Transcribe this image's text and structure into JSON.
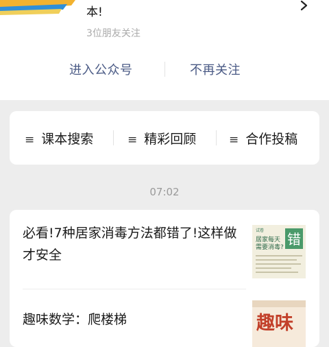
{
  "profile": {
    "description_tail": "本!",
    "followers_text": "3位朋友关注",
    "enter_button": "进入公众号",
    "unfollow_button": "不再关注"
  },
  "menu": {
    "items": [
      {
        "label": "课本搜索",
        "icon": "menu-lines-icon"
      },
      {
        "label": "精彩回顾",
        "icon": "menu-lines-icon"
      },
      {
        "label": "合作投稿",
        "icon": "menu-lines-icon"
      }
    ]
  },
  "timestamp": "07:02",
  "articles": [
    {
      "title": "必看!7种居家消毒方法都错了!这样做才安全",
      "thumbnail": {
        "brand": "试卷",
        "headline_line1": "居家每天",
        "headline_line2": "需要消毒?",
        "badge": "错"
      }
    },
    {
      "title": "趣味数学：爬楼梯",
      "thumbnail": {
        "big_text": "趣味"
      }
    }
  ],
  "colors": {
    "page_bg": "#ededed",
    "action_text": "#4a5a85",
    "thumb_badge": "#4a9a6a",
    "thumb2_text": "#c2402a"
  }
}
